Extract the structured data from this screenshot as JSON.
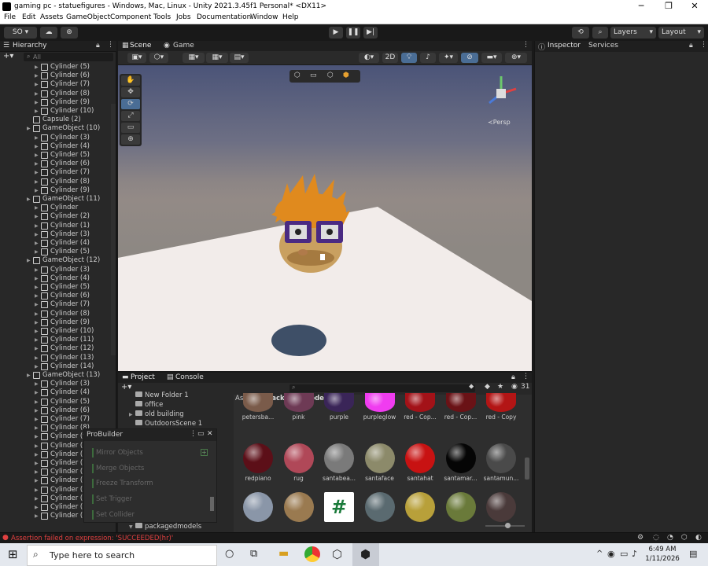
{
  "window": {
    "title": "gaming pc - statuefigures - Windows, Mac, Linux - Unity 2021.3.45f1 Personal* <DX11>",
    "controls": [
      "─",
      "❐",
      "✕"
    ]
  },
  "menu": [
    "File",
    "Edit",
    "Assets",
    "GameObject",
    "Component",
    "Tools",
    "Jobs",
    "Documentation",
    "Window",
    "Help"
  ],
  "toolbar": {
    "account": "SO ▾",
    "layers": "Layers",
    "layout": "Layout"
  },
  "hierarchy": {
    "title": "Hierarchy",
    "search_placeholder": "All",
    "rows": [
      {
        "indent": 2,
        "label": "Cylinder (5)",
        "arrow": true
      },
      {
        "indent": 2,
        "label": "Cylinder (6)",
        "arrow": true
      },
      {
        "indent": 2,
        "label": "Cylinder (7)",
        "arrow": true
      },
      {
        "indent": 2,
        "label": "Cylinder (8)",
        "arrow": true
      },
      {
        "indent": 2,
        "label": "Cylinder (9)",
        "arrow": true
      },
      {
        "indent": 2,
        "label": "Cylinder (10)",
        "arrow": true
      },
      {
        "indent": 1,
        "label": "Capsule (2)",
        "arrow": false
      },
      {
        "indent": 1,
        "label": "GameObject (10)",
        "arrow": true
      },
      {
        "indent": 2,
        "label": "Cylinder (3)",
        "arrow": true
      },
      {
        "indent": 2,
        "label": "Cylinder (4)",
        "arrow": true
      },
      {
        "indent": 2,
        "label": "Cylinder (5)",
        "arrow": true
      },
      {
        "indent": 2,
        "label": "Cylinder (6)",
        "arrow": true
      },
      {
        "indent": 2,
        "label": "Cylinder (7)",
        "arrow": true
      },
      {
        "indent": 2,
        "label": "Cylinder (8)",
        "arrow": true
      },
      {
        "indent": 2,
        "label": "Cylinder (9)",
        "arrow": true
      },
      {
        "indent": 1,
        "label": "GameObject (11)",
        "arrow": true
      },
      {
        "indent": 2,
        "label": "Cylinder",
        "arrow": true
      },
      {
        "indent": 2,
        "label": "Cylinder (2)",
        "arrow": true
      },
      {
        "indent": 2,
        "label": "Cylinder (1)",
        "arrow": true
      },
      {
        "indent": 2,
        "label": "Cylinder (3)",
        "arrow": true
      },
      {
        "indent": 2,
        "label": "Cylinder (4)",
        "arrow": true
      },
      {
        "indent": 2,
        "label": "Cylinder (5)",
        "arrow": true
      },
      {
        "indent": 1,
        "label": "GameObject (12)",
        "arrow": true
      },
      {
        "indent": 2,
        "label": "Cylinder (3)",
        "arrow": true
      },
      {
        "indent": 2,
        "label": "Cylinder (4)",
        "arrow": true
      },
      {
        "indent": 2,
        "label": "Cylinder (5)",
        "arrow": true
      },
      {
        "indent": 2,
        "label": "Cylinder (6)",
        "arrow": true
      },
      {
        "indent": 2,
        "label": "Cylinder (7)",
        "arrow": true
      },
      {
        "indent": 2,
        "label": "Cylinder (8)",
        "arrow": true
      },
      {
        "indent": 2,
        "label": "Cylinder (9)",
        "arrow": true
      },
      {
        "indent": 2,
        "label": "Cylinder (10)",
        "arrow": true
      },
      {
        "indent": 2,
        "label": "Cylinder (11)",
        "arrow": true
      },
      {
        "indent": 2,
        "label": "Cylinder (12)",
        "arrow": true
      },
      {
        "indent": 2,
        "label": "Cylinder (13)",
        "arrow": true
      },
      {
        "indent": 2,
        "label": "Cylinder (14)",
        "arrow": true
      },
      {
        "indent": 1,
        "label": "GameObject (13)",
        "arrow": true
      },
      {
        "indent": 2,
        "label": "Cylinder (3)",
        "arrow": true
      },
      {
        "indent": 2,
        "label": "Cylinder (4)",
        "arrow": true
      },
      {
        "indent": 2,
        "label": "Cylinder (5)",
        "arrow": true
      },
      {
        "indent": 2,
        "label": "Cylinder (6)",
        "arrow": true
      },
      {
        "indent": 2,
        "label": "Cylinder (7)",
        "arrow": true
      },
      {
        "indent": 2,
        "label": "Cylinder (8)",
        "arrow": true
      },
      {
        "indent": 2,
        "label": "Cylinder (9)",
        "arrow": true
      },
      {
        "indent": 2,
        "label": "Cylinder (1",
        "arrow": true
      },
      {
        "indent": 2,
        "label": "Cylinder (1",
        "arrow": true
      },
      {
        "indent": 2,
        "label": "Cylinder (1",
        "arrow": true
      },
      {
        "indent": 2,
        "label": "Cylinder (1",
        "arrow": true
      },
      {
        "indent": 2,
        "label": "Cylinder (1",
        "arrow": true
      },
      {
        "indent": 2,
        "label": "Cylinder (1",
        "arrow": true
      },
      {
        "indent": 2,
        "label": "Cylinder (1",
        "arrow": true
      },
      {
        "indent": 2,
        "label": "Cylinder (1",
        "arrow": true
      },
      {
        "indent": 2,
        "label": "Cylinder (19)",
        "arrow": true
      }
    ]
  },
  "scene": {
    "tab_scene": "Scene",
    "tab_game": "Game",
    "mode_2d": "2D",
    "persp": "Persp",
    "tools": [
      "✋",
      "✥",
      "⟳",
      "⤢",
      "▭",
      "⊕"
    ]
  },
  "inspector": {
    "tab_inspector": "Inspector",
    "tab_services": "Services"
  },
  "project": {
    "tab_project": "Project",
    "tab_console": "Console",
    "count": "31",
    "breadcrumb_root": "Assets",
    "breadcrumb_sep": ">",
    "breadcrumb_current": "packagedmodels",
    "tree": [
      {
        "label": "New Folder 1",
        "arrow": false
      },
      {
        "label": "office",
        "arrow": false
      },
      {
        "label": "old building",
        "arrow": true
      },
      {
        "label": "OutdoorsScene 1",
        "arrow": false
      }
    ],
    "tree_bottom": "packagedmodels",
    "assets_row1": [
      {
        "name": "petersba...",
        "color": "#7a5b4a"
      },
      {
        "name": "pink",
        "color": "#6e3a55"
      },
      {
        "name": "purple",
        "color": "#3a2558"
      },
      {
        "name": "purpleglow",
        "color": "#f03cf0"
      },
      {
        "name": "red - Cop...",
        "color": "#a31218"
      },
      {
        "name": "red - Cop...",
        "color": "#6a1216"
      },
      {
        "name": "red - Copy",
        "color": "#b31515"
      }
    ],
    "assets_row2": [
      {
        "name": "redpiano",
        "color": "#5c0f18"
      },
      {
        "name": "rug",
        "color": "#b04858"
      },
      {
        "name": "santabea...",
        "color": "#7a7a7a"
      },
      {
        "name": "santaface",
        "color": "#8c8a6a"
      },
      {
        "name": "santahat",
        "color": "#c81212"
      },
      {
        "name": "santamar...",
        "color": "#050505"
      },
      {
        "name": "santamun...",
        "color": "#4a4a4a"
      }
    ],
    "assets_row3": [
      {
        "name": "",
        "color": "#8a96a8"
      },
      {
        "name": "",
        "color": "#9a7a50"
      },
      {
        "name": "",
        "color": "#ffffff"
      },
      {
        "name": "",
        "color": "#5a6a70"
      },
      {
        "name": "",
        "color": "#b8a03a"
      },
      {
        "name": "",
        "color": "#6a7a3a"
      },
      {
        "name": "",
        "color": "#4a3a3a"
      }
    ]
  },
  "probuilder": {
    "title": "ProBuilder",
    "items": [
      "Mirror Objects",
      "Merge Objects",
      "Freeze Transform",
      "Set Trigger",
      "Set Collider"
    ]
  },
  "status": {
    "message": "Assertion failed on expression: 'SUCCEEDED(hr)'"
  },
  "taskbar": {
    "search_placeholder": "Type here to search",
    "time": "6:49 AM",
    "date": "1/11/2026"
  }
}
